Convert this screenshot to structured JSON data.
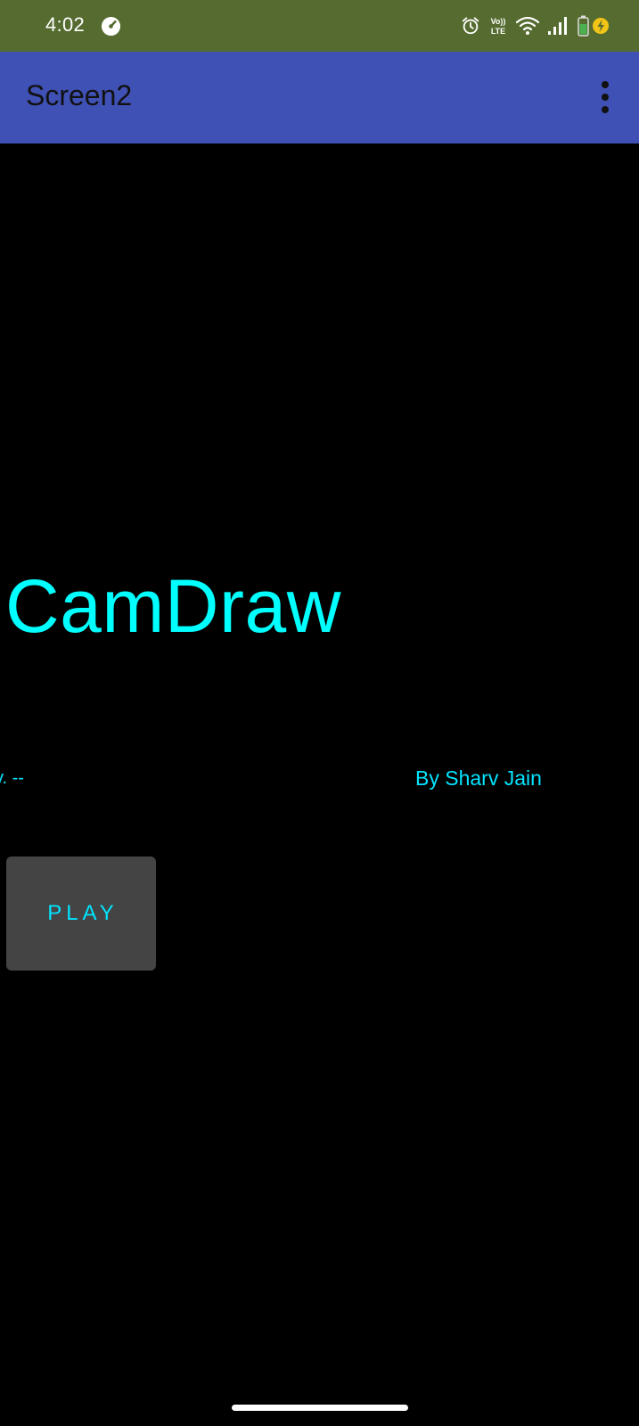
{
  "status_bar": {
    "time": "4:02",
    "background_color": "#556b2f",
    "left_icons": [
      "gauge-icon"
    ],
    "right_icons": [
      "alarm-icon",
      "volte-icon",
      "wifi-icon",
      "signal-icon",
      "battery-charging-icon"
    ]
  },
  "app_bar": {
    "title": "Screen2",
    "background_color": "#3f51b5",
    "menu_icon": "more-vert-icon"
  },
  "main": {
    "app_name": "CamDraw",
    "version_text": "v.  --",
    "author_text": "By Sharv Jain",
    "play_label": "PLAY",
    "accent_color": "#00e5ff",
    "background_color": "#000000"
  }
}
